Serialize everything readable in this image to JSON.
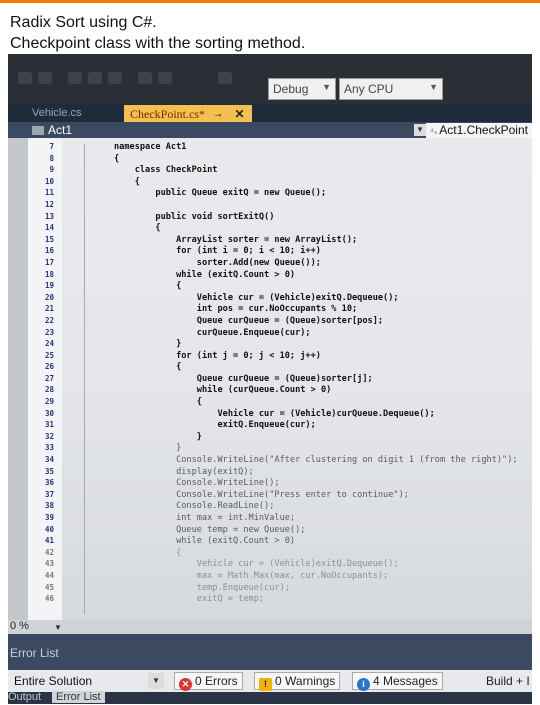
{
  "caption": {
    "line1": "Radix Sort using C#.",
    "line2": "Checkpoint class with the sorting method."
  },
  "toolbar": {
    "config_dropdown": "Debug",
    "platform_dropdown": "Any CPU"
  },
  "tabs": [
    {
      "label": "Vehicle.cs",
      "active": false
    },
    {
      "label": "CheckPoint.cs*",
      "active": true
    }
  ],
  "navbar": {
    "project": "Act1",
    "member": "Act1.CheckPoint"
  },
  "code_lines": [
    {
      "num": "7",
      "text": "namespace Act1",
      "style": ""
    },
    {
      "num": "8",
      "text": "{",
      "style": ""
    },
    {
      "num": "9",
      "text": "    class CheckPoint",
      "style": ""
    },
    {
      "num": "10",
      "text": "    {",
      "style": ""
    },
    {
      "num": "11",
      "text": "        public Queue exitQ = new Queue();",
      "style": ""
    },
    {
      "num": "12",
      "text": "",
      "style": ""
    },
    {
      "num": "13",
      "text": "        public void sortExitQ()",
      "style": ""
    },
    {
      "num": "14",
      "text": "        {",
      "style": ""
    },
    {
      "num": "15",
      "text": "            ArrayList sorter = new ArrayList();",
      "style": ""
    },
    {
      "num": "16",
      "text": "            for (int i = 0; i < 10; i++)",
      "style": ""
    },
    {
      "num": "17",
      "text": "                sorter.Add(new Queue());",
      "style": ""
    },
    {
      "num": "18",
      "text": "            while (exitQ.Count > 0)",
      "style": ""
    },
    {
      "num": "19",
      "text": "            {",
      "style": ""
    },
    {
      "num": "20",
      "text": "                Vehicle cur = (Vehicle)exitQ.Dequeue();",
      "style": ""
    },
    {
      "num": "21",
      "text": "                int pos = cur.NoOccupants % 10;",
      "style": ""
    },
    {
      "num": "22",
      "text": "                Queue curQueue = (Queue)sorter[pos];",
      "style": ""
    },
    {
      "num": "23",
      "text": "                curQueue.Enqueue(cur);",
      "style": ""
    },
    {
      "num": "24",
      "text": "            }",
      "style": ""
    },
    {
      "num": "25",
      "text": "            for (int j = 0; j < 10; j++)",
      "style": ""
    },
    {
      "num": "26",
      "text": "            {",
      "style": ""
    },
    {
      "num": "27",
      "text": "                Queue curQueue = (Queue)sorter[j];",
      "style": ""
    },
    {
      "num": "28",
      "text": "                while (curQueue.Count > 0)",
      "style": ""
    },
    {
      "num": "29",
      "text": "                {",
      "style": ""
    },
    {
      "num": "30",
      "text": "                    Vehicle cur = (Vehicle)curQueue.Dequeue();",
      "style": ""
    },
    {
      "num": "31",
      "text": "                    exitQ.Enqueue(cur);",
      "style": ""
    },
    {
      "num": "32",
      "text": "                }",
      "style": ""
    },
    {
      "num": "33",
      "text": "            }",
      "style": "fade"
    },
    {
      "num": "34",
      "text": "            Console.WriteLine(\"After clustering on digit 1 (from the right)\");",
      "style": "fade"
    },
    {
      "num": "35",
      "text": "            display(exitQ);",
      "style": "fade"
    },
    {
      "num": "36",
      "text": "            Console.WriteLine();",
      "style": "fade"
    },
    {
      "num": "37",
      "text": "            Console.WriteLine(\"Press enter to continue\");",
      "style": "fade"
    },
    {
      "num": "38",
      "text": "            Console.ReadLine();",
      "style": "fade"
    },
    {
      "num": "39",
      "text": "            int max = int.MinValue;",
      "style": "fade"
    },
    {
      "num": "40",
      "text": "            Queue temp = new Queue();",
      "style": "fade"
    },
    {
      "num": "41",
      "text": "            while (exitQ.Count > 0)",
      "style": "fade"
    },
    {
      "num": "42",
      "text": "            {",
      "style": "faint"
    },
    {
      "num": "43",
      "text": "                Vehicle cur = (Vehicle)exitQ.Dequeue();",
      "style": "faint"
    },
    {
      "num": "44",
      "text": "                max = Math.Max(max, cur.NoOccupants);",
      "style": "faint"
    },
    {
      "num": "45",
      "text": "                temp.Enqueue(cur);",
      "style": "faint"
    },
    {
      "num": "46",
      "text": "                exitQ = temp;",
      "style": "faint"
    }
  ],
  "zoom_level": "0 %",
  "error_panel": {
    "title": "Error List",
    "scope": "Entire Solution",
    "errors": "0 Errors",
    "warnings": "0 Warnings",
    "messages": "4 Messages",
    "build_filter": "Build + I"
  },
  "bottom_tabs": [
    "Output",
    "Error List"
  ]
}
